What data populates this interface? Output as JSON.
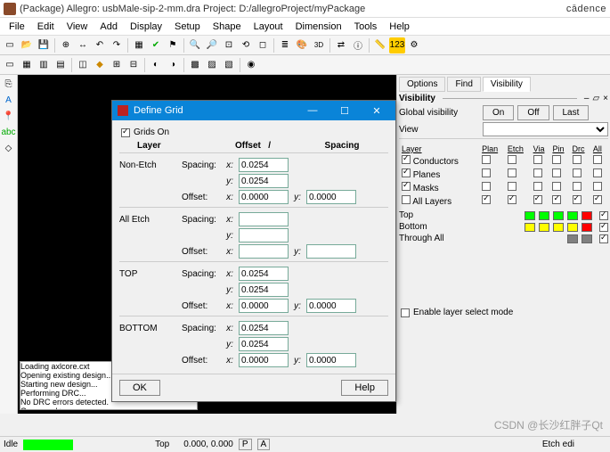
{
  "window": {
    "title": "(Package) Allegro: usbMale-sip-2-mm.dra  Project: D:/allegroProject/myPackage",
    "brand": "cādence"
  },
  "menu": [
    "File",
    "Edit",
    "View",
    "Add",
    "Display",
    "Setup",
    "Shape",
    "Layout",
    "Dimension",
    "Tools",
    "Help"
  ],
  "tabs": {
    "options": "Options",
    "find": "Find",
    "visibility": "Visibility",
    "active": "Visibility"
  },
  "vis": {
    "heading": "Visibility",
    "global_lbl": "Global visibility",
    "on": "On",
    "off": "Off",
    "last": "Last",
    "view_lbl": "View",
    "layers_lbl": "Layer",
    "cols": [
      "Plan",
      "Etch",
      "Via",
      "Pin",
      "Drc",
      "All"
    ],
    "rows": [
      {
        "name": "Conductors",
        "checked": true,
        "boxes": [
          false,
          false,
          false,
          false,
          false,
          false
        ]
      },
      {
        "name": "Planes",
        "checked": true,
        "boxes": [
          false,
          false,
          false,
          false,
          false,
          false
        ]
      },
      {
        "name": "Masks",
        "checked": true,
        "boxes": [
          false,
          false,
          false,
          false,
          false,
          false
        ]
      },
      {
        "name": "All Layers",
        "checked": false,
        "boxes": [
          true,
          true,
          true,
          true,
          true,
          true
        ]
      }
    ],
    "colorrows": [
      {
        "name": "Top",
        "colors": [
          "#00ff00",
          "#00ff00",
          "#00ff00",
          "#00ff00",
          "#ff0000"
        ],
        "all": true
      },
      {
        "name": "Bottom",
        "colors": [
          "#ffff00",
          "#ffff00",
          "#ffff00",
          "#ffff00",
          "#ff0000"
        ],
        "all": true
      },
      {
        "name": "Through All",
        "colors": [
          "#808080",
          "#808080"
        ],
        "all": true
      }
    ],
    "enable_sel": "Enable layer select mode"
  },
  "cmd": {
    "label": "Command",
    "log": "Loading axlcore.cxt\nOpening existing design...\nStarting new design...\nPerforming DRC...\nNo DRC errors detected.\nCommand >"
  },
  "status": {
    "idle": "Idle",
    "layer": "Top",
    "coord": "0.000, 0.000",
    "p": "P",
    "a": "A",
    "etch": "Etch edi"
  },
  "watermark": "CSDN @长沙红胖子Qt",
  "dialog": {
    "title": "Define Grid",
    "grids_on": "Grids On",
    "hdr": {
      "layer": "Layer",
      "offset": "Offset",
      "slash": "/",
      "spacing": "Spacing"
    },
    "labels": {
      "spacing": "Spacing:",
      "offset": "Offset:",
      "x": "x:",
      "y": "y:"
    },
    "groups": [
      {
        "name": "Non-Etch",
        "sx": "0.0254",
        "sy": "0.0254",
        "ox": "0.0000",
        "oy": "0.0000",
        "has_off_y": true
      },
      {
        "name": "All Etch",
        "sx": "",
        "sy": "",
        "ox": "",
        "oy": "",
        "has_off_y": true
      },
      {
        "name": "TOP",
        "sx": "0.0254",
        "sy": "0.0254",
        "ox": "0.0000",
        "oy": "0.0000",
        "has_off_y": true
      },
      {
        "name": "BOTTOM",
        "sx": "0.0254",
        "sy": "0.0254",
        "ox": "0.0000",
        "oy": "0.0000",
        "has_off_y": true
      }
    ],
    "ok": "OK",
    "help": "Help"
  }
}
